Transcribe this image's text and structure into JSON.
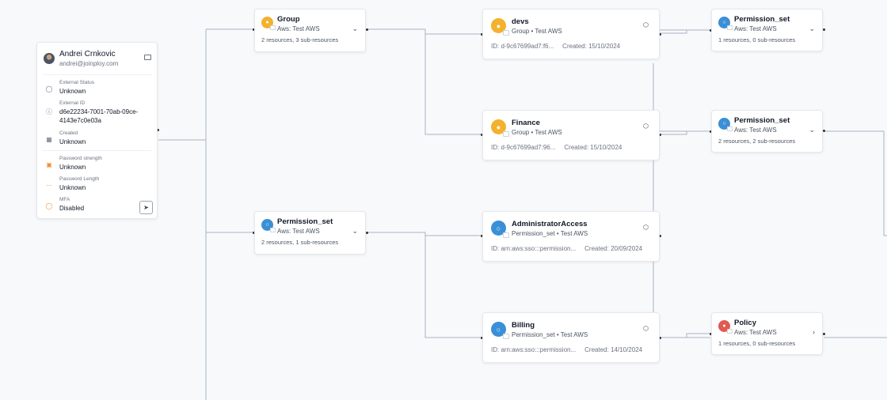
{
  "user": {
    "name": "Andrei Crnkovic",
    "email": "andrei@joinploy.com",
    "fields": [
      {
        "label": "External Status",
        "value": "Unknown",
        "icon": "person-icon"
      },
      {
        "label": "External ID",
        "value": "d6e22234-7001-70ab-09ce-4143e7c0e03a",
        "icon": "info-icon"
      },
      {
        "label": "Created",
        "value": "Unknown",
        "icon": "calendar-icon"
      },
      {
        "label": "Password strength",
        "value": "Unknown",
        "icon": "lock-icon"
      },
      {
        "label": "Password Length",
        "value": "Unknown",
        "icon": "dots-icon"
      },
      {
        "label": "MFA",
        "value": "Disabled",
        "icon": "shield-icon"
      }
    ]
  },
  "nodes": {
    "group": {
      "title": "Group",
      "subtitle": "Aws: Test AWS",
      "resources": "2 resources, 3 sub-resources",
      "chevron": "⌄"
    },
    "permset_left": {
      "title": "Permission_set",
      "subtitle": "Aws: Test AWS",
      "resources": "2 resources, 1 sub-resources",
      "chevron": "⌄"
    },
    "devs": {
      "title": "devs",
      "subtitle": "Group • Test AWS",
      "id": "ID: d-9c67699ad7:f6...",
      "created": "Created: 15/10/2024"
    },
    "finance": {
      "title": "Finance",
      "subtitle": "Group • Test AWS",
      "id": "ID: d-9c67699ad7:96...",
      "created": "Created: 15/10/2024"
    },
    "admin": {
      "title": "AdministratorAccess",
      "subtitle": "Permission_set • Test AWS",
      "id": "ID: arn:aws:sso:::permission...",
      "created": "Created: 20/09/2024"
    },
    "billing": {
      "title": "Billing",
      "subtitle": "Permission_set • Test AWS",
      "id": "ID: arn:aws:sso:::permission...",
      "created": "Created: 14/10/2024"
    },
    "permset_r1": {
      "title": "Permission_set",
      "subtitle": "Aws: Test AWS",
      "resources": "1 resources, 0 sub-resources",
      "chevron": "⌄"
    },
    "permset_r2": {
      "title": "Permission_set",
      "subtitle": "Aws: Test AWS",
      "resources": "2 resources, 2 sub-resources",
      "chevron": "⌄"
    },
    "policy": {
      "title": "Policy",
      "subtitle": "Aws: Test AWS",
      "resources": "1 resources, 0 sub-resources",
      "chevron": "›"
    }
  },
  "colors": {
    "group": "#f4b12d",
    "permission_set": "#3b8fd6",
    "policy": "#e05a4f",
    "edge": "#a9b4c2"
  }
}
